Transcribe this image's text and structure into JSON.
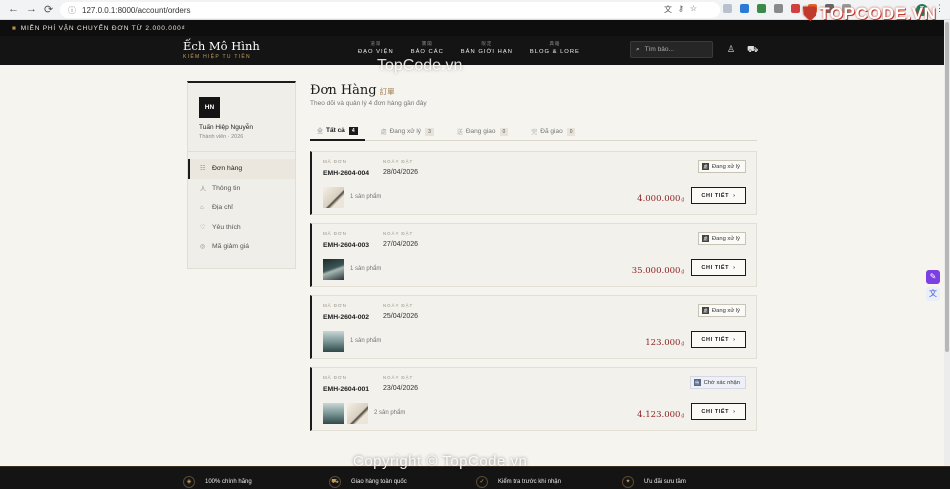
{
  "browser": {
    "url": "127.0.0.1:8000/account/orders",
    "profile_initial": "T"
  },
  "promo": {
    "text": "MIỄN PHÍ VẬN CHUYỂN ĐƠN TỪ 2.000.000₫"
  },
  "header": {
    "logo_name": "Ếch Mô Hình",
    "logo_tagline": "KIẾM HIỆP TU TIÊN",
    "menu": [
      {
        "han": "道眾",
        "label": "ĐẠO VIỆN"
      },
      {
        "han": "寶閣",
        "label": "BẢO CÁC"
      },
      {
        "han": "限定",
        "label": "BẢN GIỚI HẠN"
      },
      {
        "han": "典籍",
        "label": "BLOG & LORE"
      }
    ],
    "search_placeholder": "Tìm bảo..."
  },
  "sidebar": {
    "avatar": "HN",
    "user_name": "Tuấn Hiệp Nguyễn",
    "member_since": "Thành viên · 2026",
    "items": [
      {
        "label": "Đơn hàng",
        "icon": "orders-icon",
        "active": true
      },
      {
        "label": "Thông tin",
        "icon": "profile-icon",
        "active": false
      },
      {
        "label": "Địa chỉ",
        "icon": "address-icon",
        "active": false
      },
      {
        "label": "Yêu thích",
        "icon": "wishlist-icon",
        "active": false
      },
      {
        "label": "Mã giảm giá",
        "icon": "coupon-icon",
        "active": false
      }
    ]
  },
  "main": {
    "title": "Đơn Hàng",
    "title_han": "訂單",
    "subtitle": "Theo dõi và quản lý 4 đơn hàng gần đây",
    "tabs": [
      {
        "label": "Tất cả",
        "count": "4",
        "active": true
      },
      {
        "label": "Đang xử lý",
        "count": "3",
        "active": false
      },
      {
        "label": "Đang giao",
        "count": "0",
        "active": false
      },
      {
        "label": "Đã giao",
        "count": "0",
        "active": false
      }
    ],
    "order_code_label": "MÃ ĐƠN",
    "order_date_label": "NGÀY ĐẶT",
    "detail_button": "CHI TIẾT",
    "currency": "₫",
    "orders": [
      {
        "code": "EMH-2604-004",
        "date": "28/04/2026",
        "status": "Đang xử lý",
        "items": "1 sản phẩm",
        "total": "4.000.000"
      },
      {
        "code": "EMH-2604-003",
        "date": "27/04/2026",
        "status": "Đang xử lý",
        "items": "1 sản phẩm",
        "total": "35.000.000"
      },
      {
        "code": "EMH-2604-002",
        "date": "25/04/2026",
        "status": "Đang xử lý",
        "items": "1 sản phẩm",
        "total": "123.000"
      },
      {
        "code": "EMH-2604-001",
        "date": "23/04/2026",
        "status": "Chờ xác nhận",
        "items": "2 sản phẩm",
        "total": "4.123.000"
      }
    ]
  },
  "footer": {
    "features": [
      "100% chính hãng",
      "Giao hàng toàn quốc",
      "Kiểm tra trước khi nhận",
      "Ưu đãi sưu tầm"
    ]
  },
  "watermark": {
    "logo": "TOPCODE.VN",
    "center": "TopCode.vn",
    "copyright": "Copyright © TopCode.vn"
  }
}
